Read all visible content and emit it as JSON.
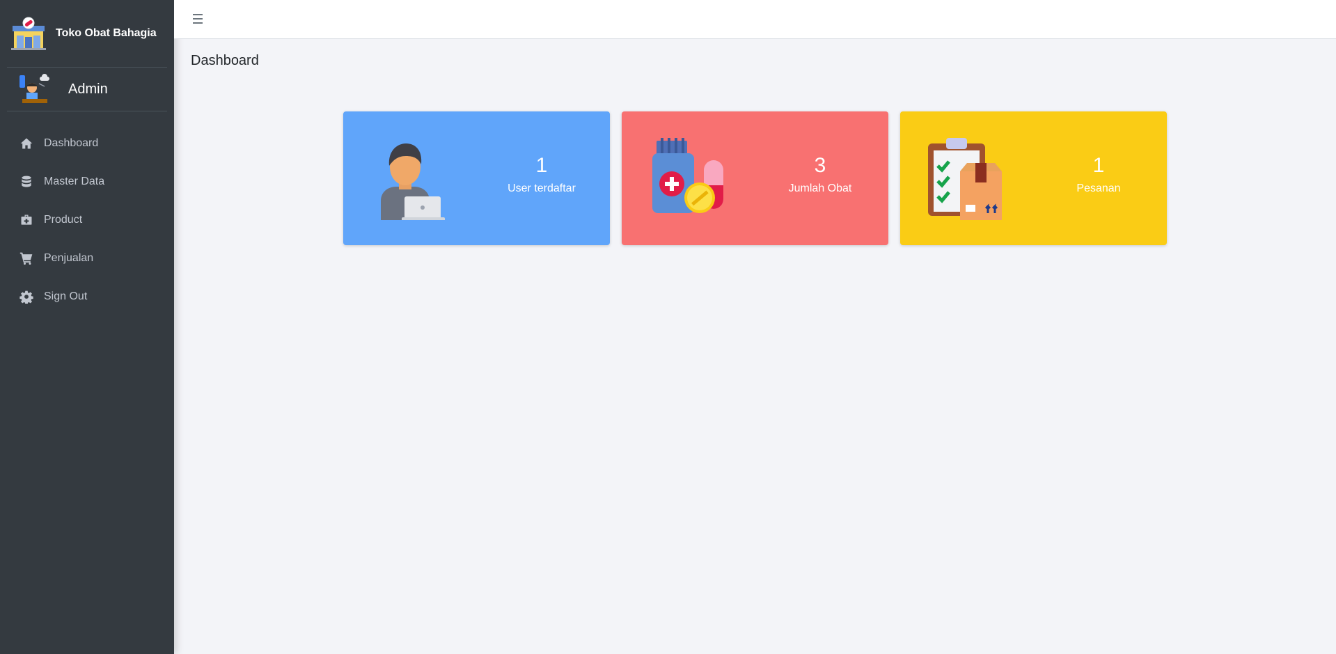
{
  "brand": {
    "name": "Toko Obat Bahagia"
  },
  "user": {
    "name": "Admin"
  },
  "nav": [
    {
      "label": "Dashboard",
      "icon": "home-icon"
    },
    {
      "label": "Master Data",
      "icon": "database-icon"
    },
    {
      "label": "Product",
      "icon": "medkit-icon"
    },
    {
      "label": "Penjualan",
      "icon": "cart-icon"
    },
    {
      "label": "Sign Out",
      "icon": "gear-icon"
    }
  ],
  "page": {
    "title": "Dashboard"
  },
  "cards": [
    {
      "value": "1",
      "label": "User terdaftar",
      "color": "#60a5fa",
      "icon": "user-laptop-icon"
    },
    {
      "value": "3",
      "label": "Jumlah Obat",
      "color": "#f87171",
      "icon": "medicine-icon"
    },
    {
      "value": "1",
      "label": "Pesanan",
      "color": "#facc15",
      "icon": "order-box-icon"
    }
  ],
  "colors": {
    "sidebar": "#343a40",
    "background": "#f3f4f8"
  }
}
